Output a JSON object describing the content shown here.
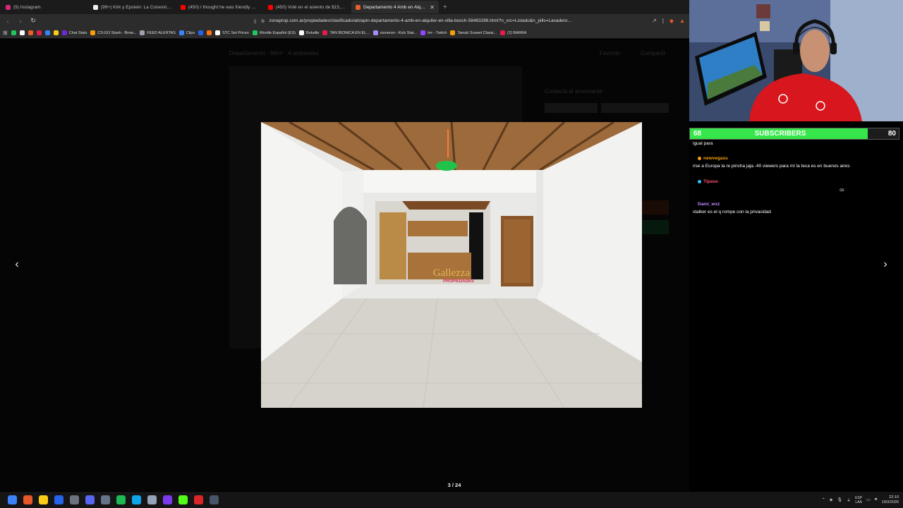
{
  "browser": {
    "tabs": [
      {
        "title": "(9) Instagram",
        "color": "#d62976",
        "active": false
      },
      {
        "title": "(99+) Kirk y Epstein: La Conexión Viral",
        "color": "#eeeeee",
        "active": false
      },
      {
        "title": "(450) I thought he was friendly 😇 P",
        "color": "#ff0000",
        "active": false
      },
      {
        "title": "(450) Volé en el asiento de $15,000 e",
        "color": "#ff0000",
        "active": false
      },
      {
        "title": "Departamento 4 Amb en Alquiler",
        "color": "#e85d2a",
        "active": true
      }
    ],
    "new_tab_symbol": "+",
    "tab_close_symbol": "✕",
    "url": "zonaprop.com.ar/propiedades/clasificado/alclapin-departamento-4-amb-en-alquiler-en-villa-bosch-58483286.html?n_src=Listado&n_pills=Lavadero...",
    "bookmarks": [
      {
        "label": "",
        "color": "#22c55e"
      },
      {
        "label": "",
        "color": "#ffffff"
      },
      {
        "label": "",
        "color": "#e85d2a"
      },
      {
        "label": "",
        "color": "#e11d48"
      },
      {
        "label": "",
        "color": "#3b82f6"
      },
      {
        "label": "",
        "color": "#facc15"
      },
      {
        "label": "Chat Stats",
        "color": "#6d28d9"
      },
      {
        "label": "CS:GO Stash - Brow...",
        "color": "#f59e0b"
      },
      {
        "label": "FEED ALERTAS",
        "color": "#9ca3af"
      },
      {
        "label": "Clips",
        "color": "#3b82f6"
      },
      {
        "label": "",
        "color": "#2563eb"
      },
      {
        "label": "",
        "color": "#f97316"
      },
      {
        "label": "STC Set Prices",
        "color": "#ffffff"
      },
      {
        "label": "Wordle Español (ES)",
        "color": "#22c55e"
      },
      {
        "label": "Boludle",
        "color": "#ffffff"
      },
      {
        "label": "TAN BIONICA EN EL...",
        "color": "#e11d48"
      },
      {
        "label": "sioneron - Kick Stat...",
        "color": "#a78bfa"
      },
      {
        "label": "trrr - Twitch",
        "color": "#9146ff"
      },
      {
        "label": "Tanuki Sunset Classi...",
        "color": "#f59e0b"
      },
      {
        "label": "(2) BARRA",
        "color": "#e11d48"
      }
    ]
  },
  "page": {
    "heading": "Departamento · 68m² · 4 ambientes",
    "links": [
      "Favorito",
      "Compartir"
    ],
    "contact_title": "Contactá al anunciante",
    "watermark": "Gallezza",
    "watermark_sub": "PROPIEDADES"
  },
  "gallery": {
    "prev_symbol": "‹",
    "next_symbol": "›",
    "counter": "3 / 24"
  },
  "subscribers": {
    "current": "68",
    "label": "SUBSCRIBERS",
    "goal": "80",
    "progress": 0.85,
    "color": "#36e64a"
  },
  "chat": {
    "messages": [
      {
        "user": "",
        "user_color": "",
        "text": "igual para"
      },
      {
        "user": "newvegass",
        "user_color": "#f59e0b",
        "text": "irse a Europa la re pincha jaja -40 viewers para mí la teca es en buenos aires"
      },
      {
        "user": "Tipaso",
        "user_color": "#ff4d6d",
        "text": ""
      },
      {
        "user": "Dami_wxz",
        "user_color": "#c084fc",
        "text": "stalker es el q rompe con la privacidad"
      }
    ]
  },
  "taskbar": {
    "icons": [
      {
        "name": "windows-start",
        "color": "#3b82f6"
      },
      {
        "name": "brave",
        "color": "#e8572a"
      },
      {
        "name": "file-explorer",
        "color": "#facc15"
      },
      {
        "name": "app-blue",
        "color": "#2563eb"
      },
      {
        "name": "obs",
        "color": "#6b7280"
      },
      {
        "name": "discord",
        "color": "#5865f2"
      },
      {
        "name": "app-gray",
        "color": "#64748b"
      },
      {
        "name": "spotify",
        "color": "#1db954"
      },
      {
        "name": "app-teal",
        "color": "#0ea5e9"
      },
      {
        "name": "app-light",
        "color": "#94a3b8"
      },
      {
        "name": "app-purple",
        "color": "#7c3aed"
      },
      {
        "name": "kick",
        "color": "#53fc18"
      },
      {
        "name": "app-red",
        "color": "#dc2626"
      },
      {
        "name": "calculator",
        "color": "#475569"
      }
    ],
    "language": "ESP",
    "language_sub": "LAA",
    "time": "22:10",
    "date": "19/3/2026"
  }
}
